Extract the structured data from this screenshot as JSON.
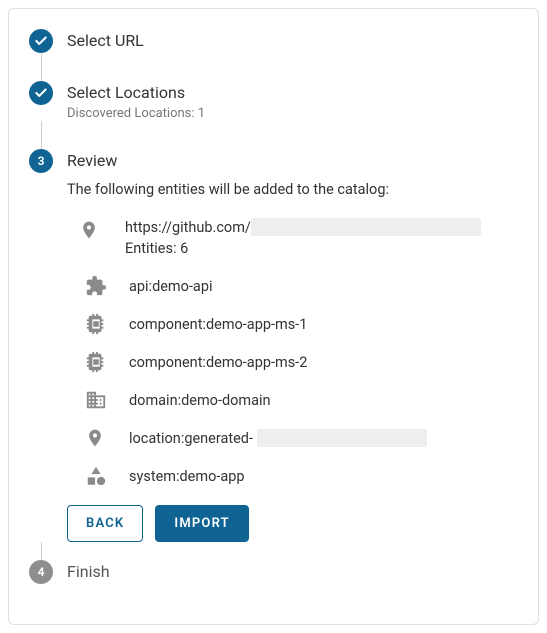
{
  "steps": {
    "s1": {
      "title": "Select URL"
    },
    "s2": {
      "title": "Select Locations",
      "subtitle": "Discovered Locations: 1"
    },
    "s3": {
      "number": "3",
      "title": "Review",
      "description": "The following entities will be added to the catalog:"
    },
    "s4": {
      "number": "4",
      "title": "Finish"
    }
  },
  "review": {
    "url_prefix": "https://github.com/",
    "entities_count": "Entities: 6",
    "items": [
      {
        "label": "api:demo-api"
      },
      {
        "label": "component:demo-app-ms-1"
      },
      {
        "label": "component:demo-app-ms-2"
      },
      {
        "label": "domain:demo-domain"
      },
      {
        "label_prefix": "location:generated-"
      },
      {
        "label": "system:demo-app"
      }
    ]
  },
  "buttons": {
    "back": "BACK",
    "import": "IMPORT"
  }
}
